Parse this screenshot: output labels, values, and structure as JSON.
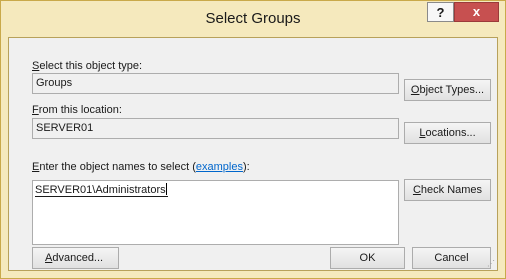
{
  "window": {
    "title": "Select Groups",
    "help_glyph": "?",
    "close_glyph": "x"
  },
  "object_type": {
    "label_u": "S",
    "label_rest": "elect this object type:",
    "value": "Groups",
    "button_u": "O",
    "button_rest": "bject Types..."
  },
  "location": {
    "label_u": "F",
    "label_rest": "rom this location:",
    "value": "SERVER01",
    "button_u": "L",
    "button_rest": "ocations..."
  },
  "names": {
    "label_u": "E",
    "label_pre": "nter the object names to select (",
    "label_link": "examples",
    "label_post": "):",
    "value": "SERVER01\\Administrators",
    "check_button_u": "C",
    "check_button_rest": "heck Names"
  },
  "footer": {
    "advanced_u": "A",
    "advanced_rest": "dvanced...",
    "ok_label": "OK",
    "cancel_label": "Cancel"
  },
  "colors": {
    "title_bar": "#f5e9bd",
    "close_button": "#c75050",
    "link": "#0066cc"
  }
}
